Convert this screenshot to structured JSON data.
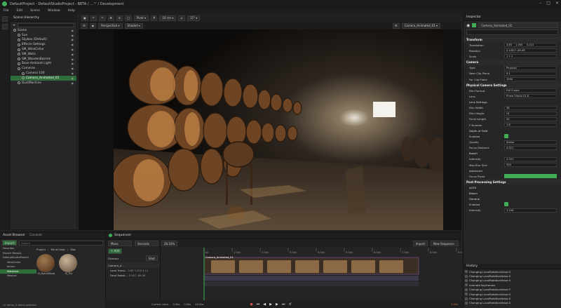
{
  "window": {
    "title": "DefaultProject - DefaultStudioProject - BETA / ...™ / Development"
  },
  "menu": [
    "File",
    "Edit",
    "Scene",
    "Window",
    "Help"
  ],
  "toolbar": {
    "pivot": "Pivot",
    "grid": "10 cm",
    "angle": "15°"
  },
  "scene_hierarchy": {
    "title": "Scene Hierarchy",
    "items": [
      {
        "label": "Scene",
        "indent": 0,
        "selected": false
      },
      {
        "label": "Sun",
        "indent": 1,
        "selected": false
      },
      {
        "label": "Skybox (Default)",
        "indent": 1,
        "selected": false
      },
      {
        "label": "Effects Settings",
        "indent": 1,
        "selected": false
      },
      {
        "label": "SM_WineCellar",
        "indent": 1,
        "selected": false
      },
      {
        "label": "SM_Walls",
        "indent": 1,
        "selected": false
      },
      {
        "label": "SM_WoodenBarrels",
        "indent": 1,
        "selected": false
      },
      {
        "label": "Base Ambient Light",
        "indent": 1,
        "selected": false
      },
      {
        "label": "Cameras",
        "indent": 1,
        "selected": false
      },
      {
        "label": "Camera 100",
        "indent": 2,
        "selected": false
      },
      {
        "label": "Camera_Animated_01",
        "indent": 2,
        "selected": true
      },
      {
        "label": "DustMachine",
        "indent": 1,
        "selected": false
      }
    ]
  },
  "viewport": {
    "perspective": "Perspective",
    "shading": "Shaded",
    "camera": "Camera_Animated_01"
  },
  "inspector": {
    "title": "Inspector",
    "object_name": "Camera_Animated_01",
    "transform": {
      "label": "Transform",
      "translation": [
        "3.85",
        "1.050",
        "4.114"
      ],
      "rotation": [
        "0",
        "4.817",
        "-89.08"
      ],
      "scale": [
        "1",
        "1",
        "1"
      ]
    },
    "camera": {
      "label": "Camera",
      "type": "Physical",
      "near": "0.1",
      "far": "1000"
    },
    "physical": {
      "label": "Physical Camera Settings",
      "film_format": "Full Frame",
      "lens": "Prime 50mm f/1.8",
      "film_width": "36",
      "film_height": "24",
      "focal_length": "50",
      "f_number": "1.8"
    },
    "dof": {
      "label": "Depth of Field",
      "enabled_label": "Enabled",
      "quality_label": "Quality",
      "quality": "Stellar",
      "focus_label": "Focus Distance",
      "focus": "4.321"
    },
    "bokeh": {
      "label": "Bokeh",
      "intensity_label": "Intensity",
      "intensity": "2.551",
      "max_size_label": "Max Blur Size",
      "max_size": "500"
    },
    "advanced": "Advanced",
    "post": {
      "label": "Post-Processing Settings",
      "aces": "ACES",
      "bloom": "Bloom",
      "general": "General",
      "enabled_label": "Enabled",
      "intensity_label": "Intensity",
      "intensity": "1.194"
    }
  },
  "history": {
    "title": "History",
    "items": [
      "Changing LocalRotationValue.X",
      "Changing LocalRotationValue.X",
      "Changing LocalRotationValue.X",
      "Animate Keyframes",
      "Changing LocalRotationValue.Y",
      "Changing LocalRotationValue.X",
      "Changing LocalRotationValue.X",
      "Changing LocalRotationValue.X"
    ]
  },
  "asset_browser": {
    "title": "Asset Browser",
    "tab2": "Console",
    "import_label": "Import",
    "search_placeholder": "Search",
    "path": [
      "Project",
      "WineCellar",
      "Mat"
    ],
    "tree": [
      "Favorites",
      "Search Results",
      "DefaultStudioProject",
      "WineCellar",
      "Actors",
      "Materials",
      "Meshes"
    ],
    "assets": [
      "M_BarrelWood",
      "M_Tile"
    ],
    "status": "11 Items, 0 Items selected"
  },
  "sequencer": {
    "title": "Sequencer",
    "mode": "Move",
    "time_unit": "Seconds",
    "zoom": "28.16%",
    "add_label": "+ Add",
    "import_label": "Import",
    "sequence_label": "New Sequence",
    "track": "Camera_A...",
    "shot": "Shot",
    "director": "Director",
    "tracks": [
      "Local Transl...",
      "Focal Rotati..."
    ],
    "track_values": [
      "3.85 1.050 4.11",
      "-5.957 -89.08"
    ],
    "clip_label": "Camera_Animated_01",
    "ticks": [
      "0s",
      "1.00s",
      "2.00s",
      "3.00s",
      "4.00s",
      "5.00s",
      "6.00s",
      "7.00s",
      "8.00s",
      "9.00s",
      "10s"
    ],
    "current_label": "Current value",
    "time_a": "0.00s",
    "time_b": "0.00s",
    "time_c": "10.00s",
    "time_d": "3.00s"
  }
}
